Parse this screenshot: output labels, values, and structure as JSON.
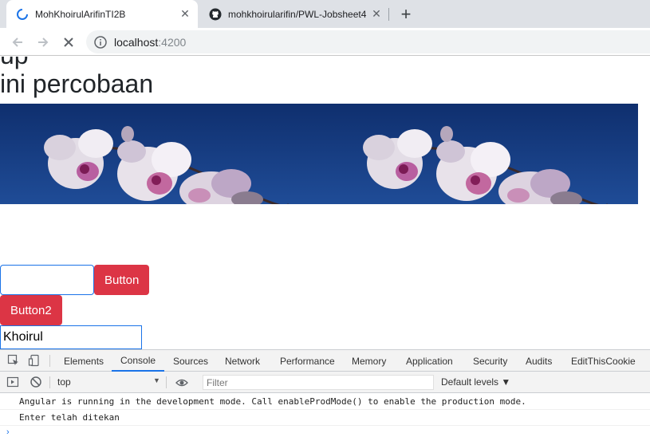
{
  "browser": {
    "tabs": [
      {
        "title": "MohKhoirulArifinTI2B",
        "favicon": "loading-spinner-icon",
        "active": true
      },
      {
        "title": "mohkhoirularifin/PWL-Jobsheet4",
        "favicon": "github-icon",
        "active": false
      }
    ],
    "new_tab": "+",
    "close_glyph": "✕",
    "address": {
      "host": "localhost",
      "port": ":4200"
    }
  },
  "page": {
    "clipped_heading": "up",
    "heading": "ini percobaan",
    "button1_label": "Button",
    "button2_label": "Button2",
    "input2_value": "Khoirul"
  },
  "devtools": {
    "tabs": [
      "Elements",
      "Console",
      "Sources",
      "Network",
      "Performance",
      "Memory",
      "Application",
      "Security",
      "Audits",
      "EditThisCookie"
    ],
    "active_tab": "Console",
    "context": "top",
    "filter_placeholder": "Filter",
    "levels": "Default levels ▼",
    "logs": [
      "Angular is running in the development mode. Call enableProdMode() to enable the production mode.",
      "Enter telah ditekan"
    ],
    "prompt": "›"
  },
  "colors": {
    "button": "#dc3545",
    "accent": "#1a73e8"
  }
}
